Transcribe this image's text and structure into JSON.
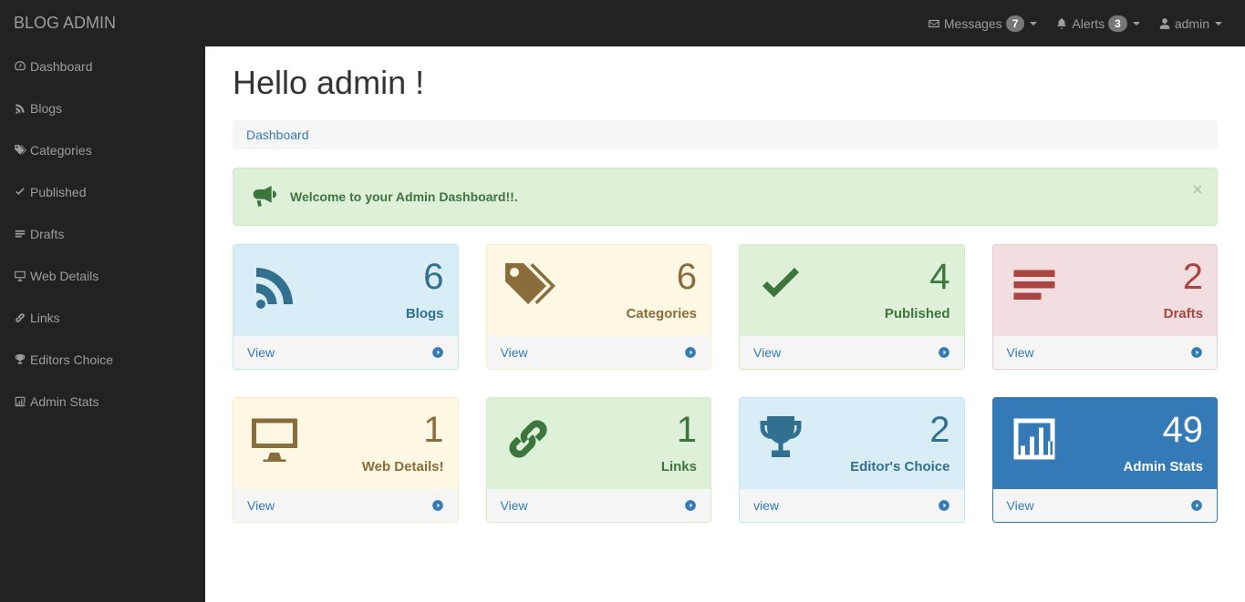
{
  "header": {
    "brand": "BLOG ADMIN",
    "messages_label": "Messages",
    "messages_count": "7",
    "alerts_label": "Alerts",
    "alerts_count": "3",
    "user_label": "admin"
  },
  "sidebar": {
    "items": [
      {
        "label": "Dashboard",
        "icon": "dashboard"
      },
      {
        "label": "Blogs",
        "icon": "rss"
      },
      {
        "label": "Categories",
        "icon": "tags"
      },
      {
        "label": "Published",
        "icon": "check"
      },
      {
        "label": "Drafts",
        "icon": "list"
      },
      {
        "label": "Web Details",
        "icon": "desktop"
      },
      {
        "label": "Links",
        "icon": "link"
      },
      {
        "label": "Editors Choice",
        "icon": "trophy"
      },
      {
        "label": "Admin Stats",
        "icon": "barchart"
      }
    ]
  },
  "page": {
    "title": "Hello admin !",
    "breadcrumb": "Dashboard",
    "alert_text": "Welcome to your Admin Dashboard!!"
  },
  "cards": [
    {
      "count": "6",
      "label": "Blogs",
      "view": "View",
      "style": "info",
      "icon": "rss"
    },
    {
      "count": "6",
      "label": "Categories",
      "view": "View",
      "style": "warning",
      "icon": "tags"
    },
    {
      "count": "4",
      "label": "Published",
      "view": "View",
      "style": "success",
      "icon": "check"
    },
    {
      "count": "2",
      "label": "Drafts",
      "view": "View",
      "style": "danger",
      "icon": "list"
    },
    {
      "count": "1",
      "label": "Web Details!",
      "view": "View",
      "style": "warning",
      "icon": "desktop"
    },
    {
      "count": "1",
      "label": "Links",
      "view": "View",
      "style": "success",
      "icon": "link"
    },
    {
      "count": "2",
      "label": "Editor's Choice",
      "view": "view",
      "style": "info",
      "icon": "trophy"
    },
    {
      "count": "49",
      "label": "Admin Stats",
      "view": "View",
      "style": "primary",
      "icon": "barchart"
    }
  ]
}
